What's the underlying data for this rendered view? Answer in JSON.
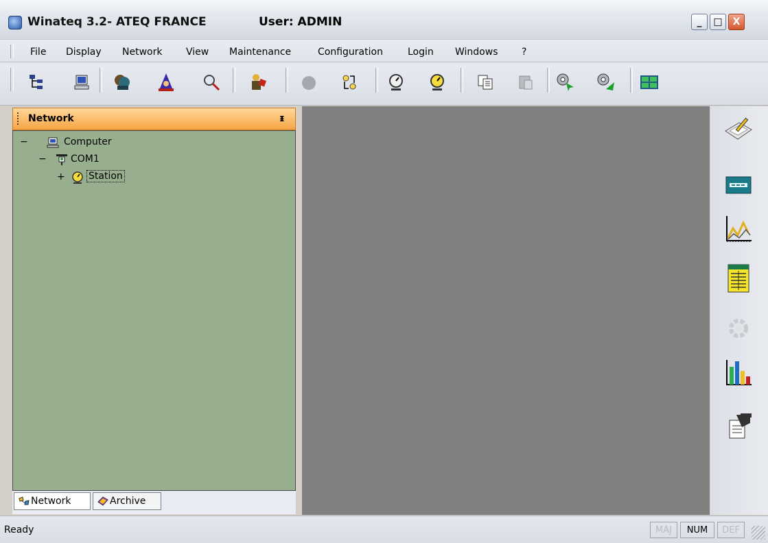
{
  "window": {
    "title": "Winateq 3.2- ATEQ FRANCE",
    "user": "User: ADMIN",
    "buttons": {
      "minimize": "_",
      "maximize": "□",
      "close": "X"
    }
  },
  "menu": [
    {
      "label": "File"
    },
    {
      "label": "Display"
    },
    {
      "label": "Network"
    },
    {
      "label": "View"
    },
    {
      "label": "Maintenance"
    },
    {
      "label": "Configuration"
    },
    {
      "label": "Login"
    },
    {
      "label": "Windows"
    },
    {
      "label": "?"
    }
  ],
  "toolbar": {
    "icons": [
      "network-tree-icon",
      "computer-icon",
      "operator-icon",
      "wizard-icon",
      "search-icon",
      "worker-icon",
      "record-icon",
      "connect-icon",
      "gauge-icon",
      "station-gauge-icon",
      "copy-icon",
      "paste-icon",
      "send-icon",
      "receive-icon",
      "layout-icon"
    ]
  },
  "panel": {
    "title": "Network",
    "tree": [
      {
        "toggle": "−",
        "label": "Computer",
        "icon": "computer-icon"
      },
      {
        "toggle": "−",
        "label": "COM1",
        "icon": "com-port-icon"
      },
      {
        "toggle": "+",
        "label": "Station",
        "icon": "station-icon",
        "selected": true
      }
    ],
    "tabs": [
      {
        "label": "Network",
        "icon": "network-tab-icon",
        "active": true
      },
      {
        "label": "Archive",
        "icon": "archive-tab-icon",
        "active": false
      }
    ]
  },
  "sidebar": {
    "icons": [
      "edit-parameters-icon",
      "display-panel-icon",
      "curve-chart-icon",
      "results-table-icon",
      "settings-disabled-icon",
      "statistics-chart-icon",
      "report-icon"
    ]
  },
  "status": {
    "text": "Ready",
    "indicators": [
      {
        "label": "MAJ",
        "active": false
      },
      {
        "label": "NUM",
        "active": true
      },
      {
        "label": "DEF",
        "active": false
      }
    ]
  }
}
